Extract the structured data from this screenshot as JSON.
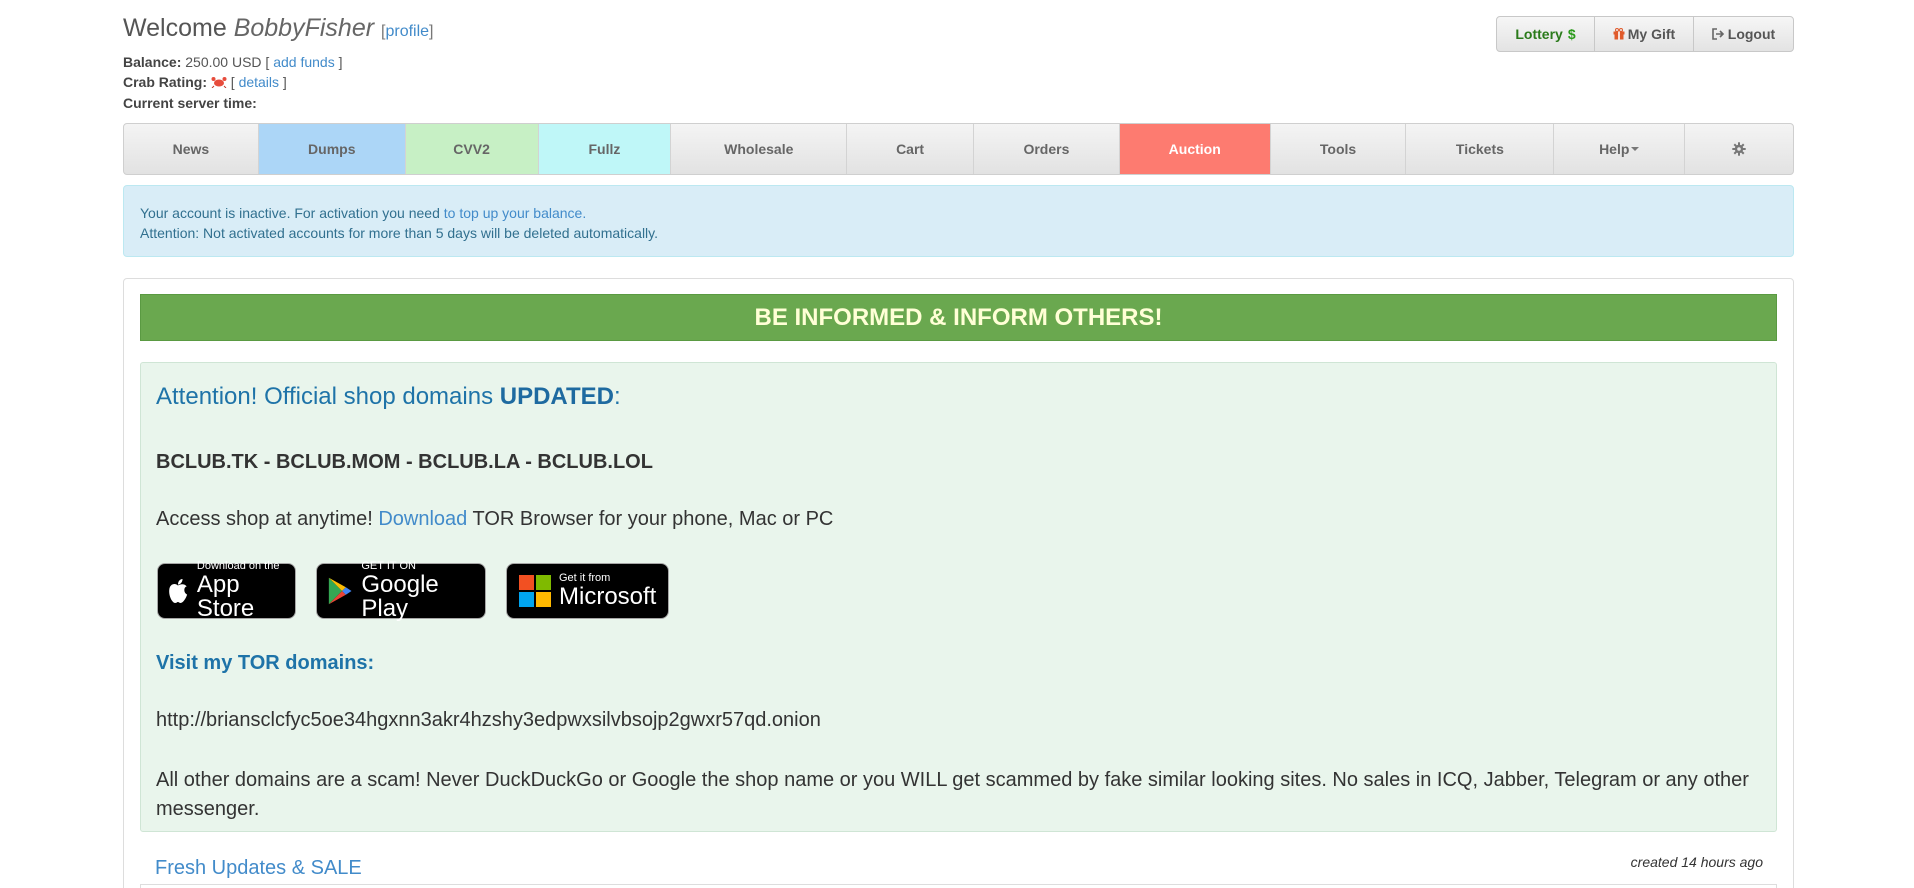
{
  "header": {
    "welcome_prefix": "Welcome",
    "username": "BobbyFisher",
    "profile_open": "[",
    "profile_link": "profile",
    "profile_close": "]",
    "balance_label": "Balance:",
    "balance_value": "250.00 USD",
    "add_funds": "add funds",
    "crab_label": "Crab Rating:",
    "details": "details",
    "server_time_label": "Current server time:"
  },
  "top_buttons": {
    "lottery": "Lottery",
    "gift": "My Gift",
    "logout": "Logout"
  },
  "nav": {
    "items": [
      "News",
      "Dumps",
      "CVV2",
      "Fullz",
      "Wholesale",
      "Cart",
      "Orders",
      "Auction",
      "Tools",
      "Tickets",
      "Help"
    ]
  },
  "alert": {
    "line1_text": "Your account is inactive. For activation you need",
    "line1_link": "to top up your balance.",
    "line2": "Attention: Not activated accounts for more than 5 days will be deleted automatically."
  },
  "banner": "BE INFORMED & INFORM OTHERS!",
  "notice": {
    "attention_text": "Attention! Official shop domains",
    "attention_bold": "UPDATED",
    "attention_colon": ":",
    "domains": "BCLUB.TK - BCLUB.MOM - BCLUB.LA - BCLUB.LOL",
    "access_prefix": "Access shop at anytime!",
    "access_link": "Download",
    "access_suffix": "TOR Browser for your phone, Mac or PC",
    "appstore_small": "Download on the",
    "appstore_big": "App Store",
    "googleplay_small": "GET IT ON",
    "googleplay_big": "Google Play",
    "microsoft_small": "Get it from",
    "microsoft_big": "Microsoft",
    "visit": "Visit my TOR domains:",
    "onion": "http://briansclcfyc5oe34hgxnn3akr4hzshy3edpwxsilvbsojp2gwxr57qd.onion",
    "scam": "All other domains are a scam! Never DuckDuckGo or Google the shop name or you WILL get scammed by fake similar looking sites. No sales in ICQ, Jabber, Telegram or any other messenger."
  },
  "updates": {
    "title": "Fresh Updates & SALE",
    "created": "created 14 hours ago"
  },
  "colors": {
    "dumps": "#acd6f7",
    "cvv2": "#c7f0c5",
    "fullz": "#bff7f8",
    "auction": "#fd7b70",
    "banner": "#6aa84f",
    "alert_bg": "#d9edf7",
    "notice_bg": "#e9f5ec"
  }
}
